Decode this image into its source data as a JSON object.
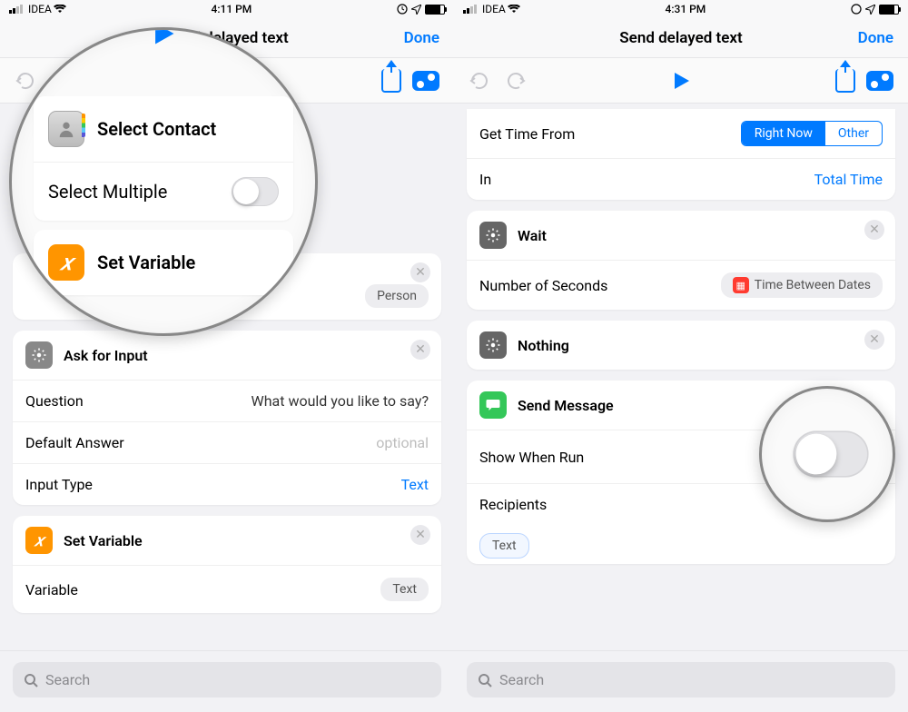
{
  "left": {
    "statusbar": {
      "carrier": "IDEA",
      "time": "4:11 PM"
    },
    "nav": {
      "title": "Send delayed text",
      "done": "Done"
    },
    "magnifier": {
      "selectContact": "Select Contact",
      "selectMultiple": "Select Multiple",
      "setVariable": "Set Variable"
    },
    "person_pill": "Person",
    "ask": {
      "title": "Ask for Input",
      "question_label": "Question",
      "question_value": "What would you like to say?",
      "default_label": "Default Answer",
      "default_value": "optional",
      "type_label": "Input Type",
      "type_value": "Text"
    },
    "setvar2": {
      "title": "Set Variable",
      "var_label": "Variable",
      "var_value": "Text"
    },
    "search_placeholder": "Search"
  },
  "right": {
    "statusbar": {
      "carrier": "IDEA",
      "time": "4:31 PM"
    },
    "nav": {
      "title": "Send delayed text",
      "done": "Done"
    },
    "gettime": {
      "label": "Get Time From",
      "seg_right_now": "Right Now",
      "seg_other": "Other",
      "in_label": "In",
      "in_value": "Total Time"
    },
    "wait": {
      "title": "Wait",
      "seconds_label": "Number of Seconds",
      "seconds_value": "Time Between Dates"
    },
    "nothing": {
      "title": "Nothing"
    },
    "sendmsg": {
      "title": "Send Message",
      "show_label": "Show When Run",
      "recipients_label": "Recipients",
      "text_pill": "Text"
    },
    "search_placeholder": "Search"
  }
}
